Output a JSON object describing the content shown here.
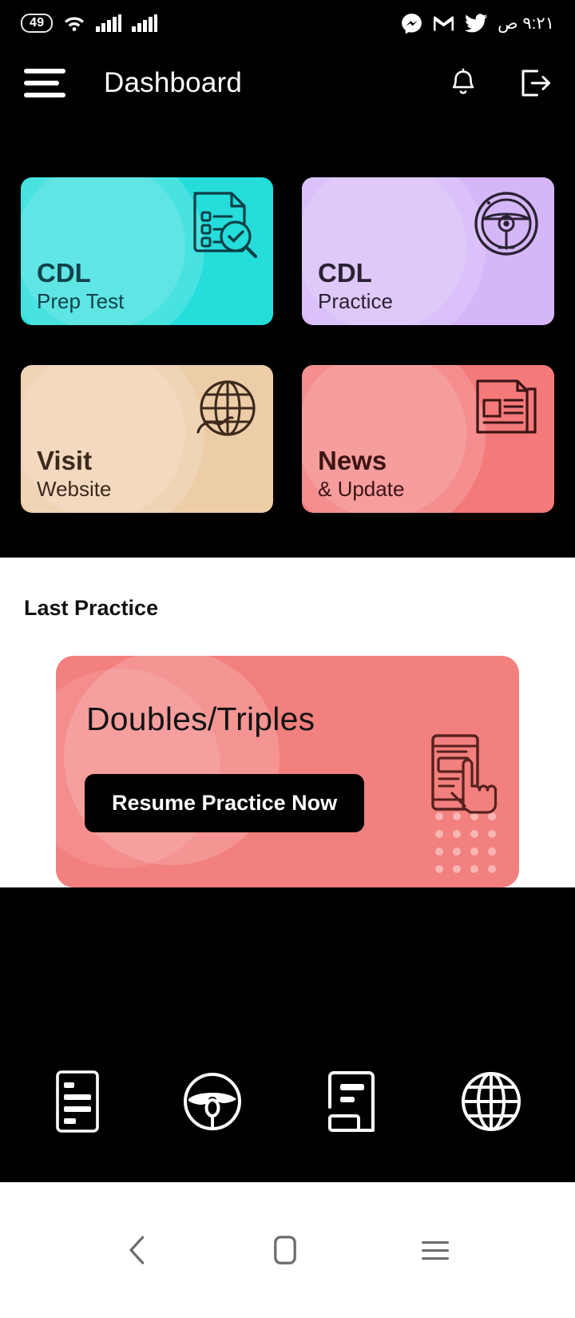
{
  "status_bar": {
    "battery_level": "49",
    "time": "٩:٢١ ص",
    "icons": [
      "battery-icon",
      "wifi-icon",
      "signal-sim1-icon",
      "signal-sim2-icon",
      "messenger-icon",
      "gmail-icon",
      "twitter-icon"
    ]
  },
  "app_bar": {
    "title": "Dashboard",
    "menu_icon": "hamburger-menu-icon",
    "notification_icon": "bell-icon",
    "logout_icon": "logout-icon"
  },
  "tiles": [
    {
      "title": "CDL",
      "subtitle": "Prep Test",
      "bg": "#25DDDB",
      "text_color": "#10424A",
      "icon": "document-search-check-icon"
    },
    {
      "title": "CDL",
      "subtitle": "Practice",
      "bg": "#D5B6F8",
      "text_color": "#2A2233",
      "icon": "steering-wheel-icon"
    },
    {
      "title": "Visit",
      "subtitle": "Website",
      "bg": "#EDCCA8",
      "text_color": "#3B2A1C",
      "icon": "globe-icon"
    },
    {
      "title": "News",
      "subtitle": "& Update",
      "bg": "#F47A7A",
      "text_color": "#3D1414",
      "icon": "newspaper-icon"
    }
  ],
  "last_practice": {
    "section_title": "Last Practice",
    "card_title": "Doubles/Triples",
    "button_label": "Resume Practice Now",
    "card_bg": "#F2807E",
    "button_bg": "#000000",
    "art_icon": "phone-tap-hand-icon"
  },
  "bottom_nav": {
    "items": [
      {
        "icon": "test-document-icon",
        "name": "prep-test"
      },
      {
        "icon": "steering-wheel-icon",
        "name": "practice"
      },
      {
        "icon": "news-article-icon",
        "name": "news"
      },
      {
        "icon": "globe-icon",
        "name": "website"
      }
    ]
  },
  "system_nav": {
    "back": "back-chevron-icon",
    "home": "home-square-icon",
    "recents": "recents-lines-icon"
  }
}
